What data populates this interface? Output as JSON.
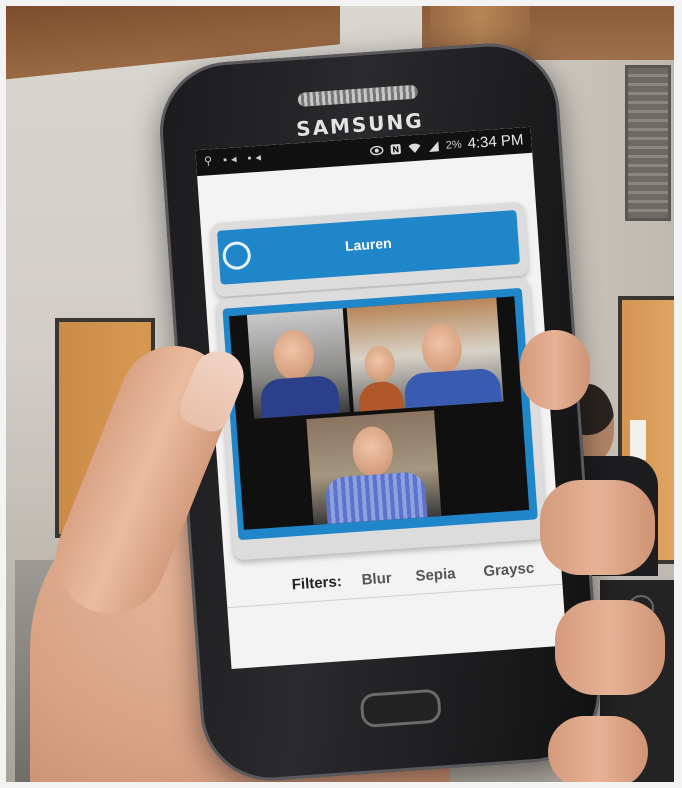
{
  "phone": {
    "brand": "SAMSUNG"
  },
  "status_bar": {
    "left_icons": "⚲ ▪◂ ▪◂",
    "battery": "2%",
    "time": "4:34 PM"
  },
  "call": {
    "caller_name": "Lauren"
  },
  "filters": {
    "label": "Filters:",
    "options": [
      "Blur",
      "Sepia",
      "Graysc"
    ]
  },
  "colors": {
    "accent": "#1f86c9",
    "screen_bg": "#f3f3f3"
  },
  "icons": {
    "record": "record-ring-icon",
    "wifi": "wifi-icon",
    "signal": "signal-icon",
    "nfc": "nfc-icon",
    "eye": "smart-stay-icon"
  }
}
